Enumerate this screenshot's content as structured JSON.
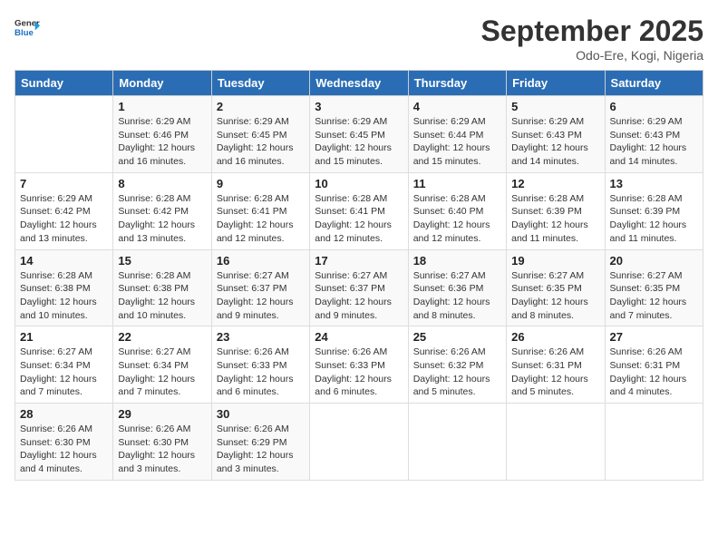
{
  "header": {
    "logo_line1": "General",
    "logo_line2": "Blue",
    "month": "September 2025",
    "location": "Odo-Ere, Kogi, Nigeria"
  },
  "weekdays": [
    "Sunday",
    "Monday",
    "Tuesday",
    "Wednesday",
    "Thursday",
    "Friday",
    "Saturday"
  ],
  "weeks": [
    [
      {
        "day": "",
        "info": ""
      },
      {
        "day": "1",
        "info": "Sunrise: 6:29 AM\nSunset: 6:46 PM\nDaylight: 12 hours\nand 16 minutes."
      },
      {
        "day": "2",
        "info": "Sunrise: 6:29 AM\nSunset: 6:45 PM\nDaylight: 12 hours\nand 16 minutes."
      },
      {
        "day": "3",
        "info": "Sunrise: 6:29 AM\nSunset: 6:45 PM\nDaylight: 12 hours\nand 15 minutes."
      },
      {
        "day": "4",
        "info": "Sunrise: 6:29 AM\nSunset: 6:44 PM\nDaylight: 12 hours\nand 15 minutes."
      },
      {
        "day": "5",
        "info": "Sunrise: 6:29 AM\nSunset: 6:43 PM\nDaylight: 12 hours\nand 14 minutes."
      },
      {
        "day": "6",
        "info": "Sunrise: 6:29 AM\nSunset: 6:43 PM\nDaylight: 12 hours\nand 14 minutes."
      }
    ],
    [
      {
        "day": "7",
        "info": "Sunrise: 6:29 AM\nSunset: 6:42 PM\nDaylight: 12 hours\nand 13 minutes."
      },
      {
        "day": "8",
        "info": "Sunrise: 6:28 AM\nSunset: 6:42 PM\nDaylight: 12 hours\nand 13 minutes."
      },
      {
        "day": "9",
        "info": "Sunrise: 6:28 AM\nSunset: 6:41 PM\nDaylight: 12 hours\nand 12 minutes."
      },
      {
        "day": "10",
        "info": "Sunrise: 6:28 AM\nSunset: 6:41 PM\nDaylight: 12 hours\nand 12 minutes."
      },
      {
        "day": "11",
        "info": "Sunrise: 6:28 AM\nSunset: 6:40 PM\nDaylight: 12 hours\nand 12 minutes."
      },
      {
        "day": "12",
        "info": "Sunrise: 6:28 AM\nSunset: 6:39 PM\nDaylight: 12 hours\nand 11 minutes."
      },
      {
        "day": "13",
        "info": "Sunrise: 6:28 AM\nSunset: 6:39 PM\nDaylight: 12 hours\nand 11 minutes."
      }
    ],
    [
      {
        "day": "14",
        "info": "Sunrise: 6:28 AM\nSunset: 6:38 PM\nDaylight: 12 hours\nand 10 minutes."
      },
      {
        "day": "15",
        "info": "Sunrise: 6:28 AM\nSunset: 6:38 PM\nDaylight: 12 hours\nand 10 minutes."
      },
      {
        "day": "16",
        "info": "Sunrise: 6:27 AM\nSunset: 6:37 PM\nDaylight: 12 hours\nand 9 minutes."
      },
      {
        "day": "17",
        "info": "Sunrise: 6:27 AM\nSunset: 6:37 PM\nDaylight: 12 hours\nand 9 minutes."
      },
      {
        "day": "18",
        "info": "Sunrise: 6:27 AM\nSunset: 6:36 PM\nDaylight: 12 hours\nand 8 minutes."
      },
      {
        "day": "19",
        "info": "Sunrise: 6:27 AM\nSunset: 6:35 PM\nDaylight: 12 hours\nand 8 minutes."
      },
      {
        "day": "20",
        "info": "Sunrise: 6:27 AM\nSunset: 6:35 PM\nDaylight: 12 hours\nand 7 minutes."
      }
    ],
    [
      {
        "day": "21",
        "info": "Sunrise: 6:27 AM\nSunset: 6:34 PM\nDaylight: 12 hours\nand 7 minutes."
      },
      {
        "day": "22",
        "info": "Sunrise: 6:27 AM\nSunset: 6:34 PM\nDaylight: 12 hours\nand 7 minutes."
      },
      {
        "day": "23",
        "info": "Sunrise: 6:26 AM\nSunset: 6:33 PM\nDaylight: 12 hours\nand 6 minutes."
      },
      {
        "day": "24",
        "info": "Sunrise: 6:26 AM\nSunset: 6:33 PM\nDaylight: 12 hours\nand 6 minutes."
      },
      {
        "day": "25",
        "info": "Sunrise: 6:26 AM\nSunset: 6:32 PM\nDaylight: 12 hours\nand 5 minutes."
      },
      {
        "day": "26",
        "info": "Sunrise: 6:26 AM\nSunset: 6:31 PM\nDaylight: 12 hours\nand 5 minutes."
      },
      {
        "day": "27",
        "info": "Sunrise: 6:26 AM\nSunset: 6:31 PM\nDaylight: 12 hours\nand 4 minutes."
      }
    ],
    [
      {
        "day": "28",
        "info": "Sunrise: 6:26 AM\nSunset: 6:30 PM\nDaylight: 12 hours\nand 4 minutes."
      },
      {
        "day": "29",
        "info": "Sunrise: 6:26 AM\nSunset: 6:30 PM\nDaylight: 12 hours\nand 3 minutes."
      },
      {
        "day": "30",
        "info": "Sunrise: 6:26 AM\nSunset: 6:29 PM\nDaylight: 12 hours\nand 3 minutes."
      },
      {
        "day": "",
        "info": ""
      },
      {
        "day": "",
        "info": ""
      },
      {
        "day": "",
        "info": ""
      },
      {
        "day": "",
        "info": ""
      }
    ]
  ]
}
